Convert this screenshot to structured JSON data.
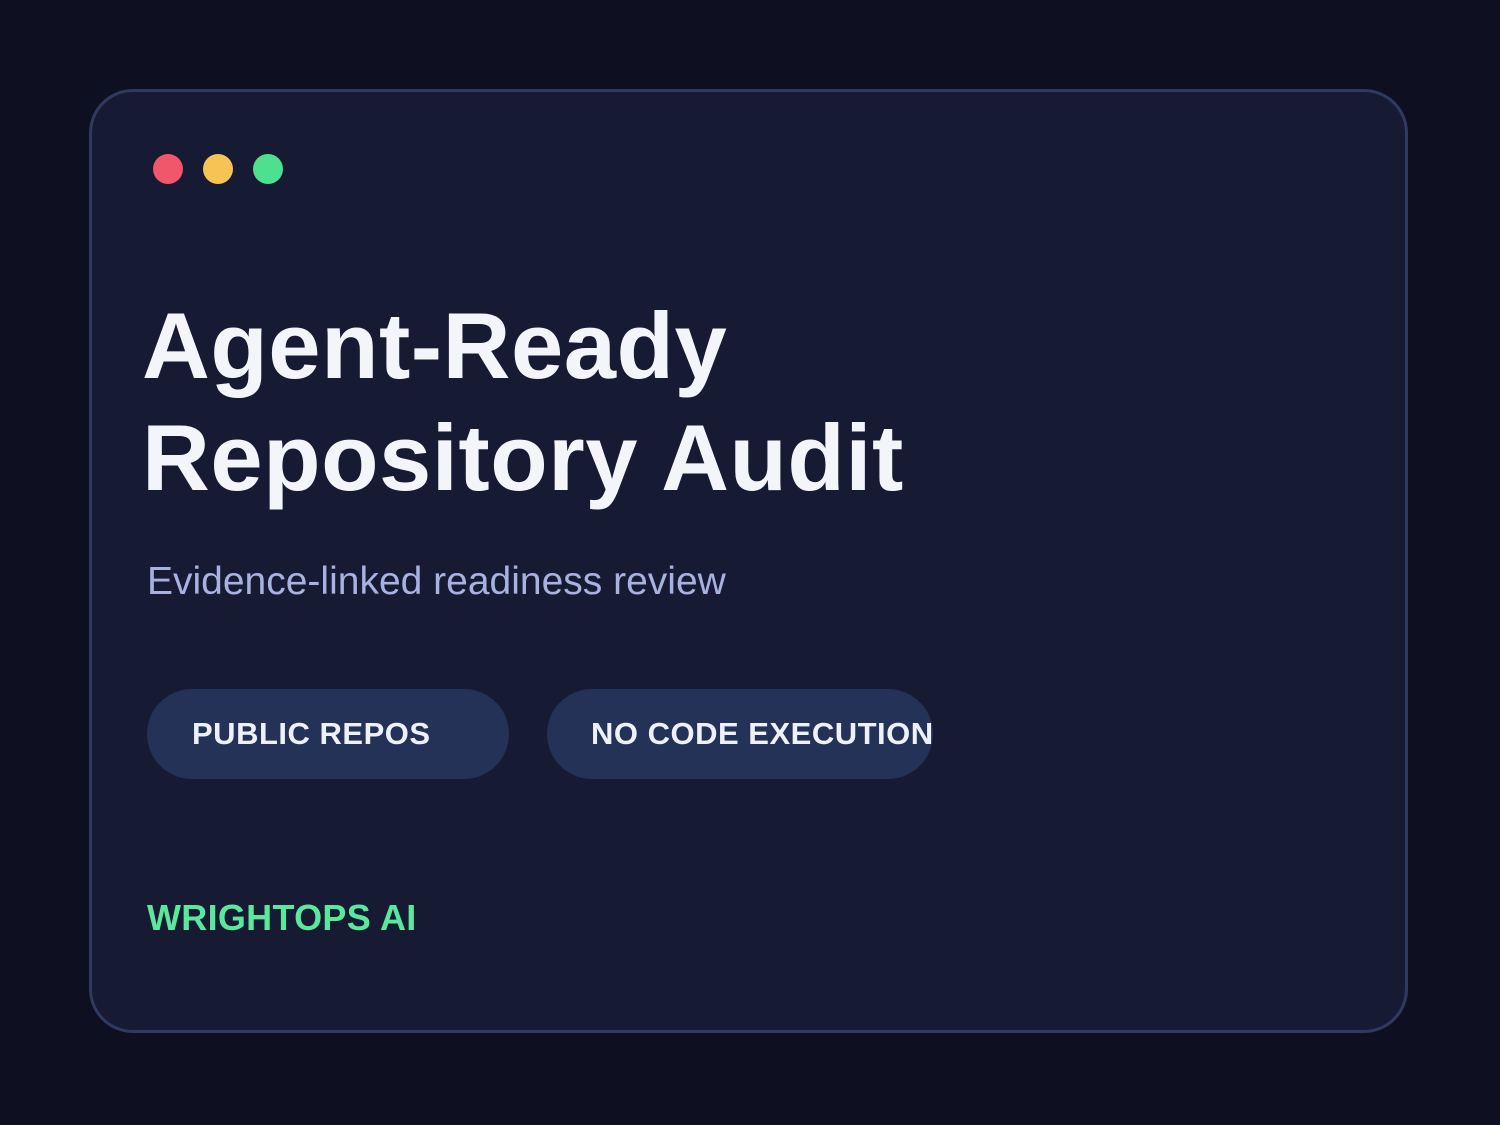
{
  "window": {
    "controls": [
      {
        "name": "close",
        "color": "#f2566b"
      },
      {
        "name": "minimize",
        "color": "#f7c453"
      },
      {
        "name": "maximize",
        "color": "#4fe08f"
      }
    ]
  },
  "heading": {
    "line1": "Agent-Ready",
    "line2": "Repository Audit"
  },
  "subtitle": "Evidence-linked readiness review",
  "tags": [
    {
      "label": "PUBLIC REPOS"
    },
    {
      "label": "NO CODE EXECUTION"
    }
  ],
  "brand": "WRIGHTOPS AI",
  "colors": {
    "background": "#0e1022",
    "card": "#161a33",
    "card_border": "#2f3a60",
    "pill": "#233256",
    "subtitle": "#a8b2e0",
    "brand": "#5be89c"
  }
}
